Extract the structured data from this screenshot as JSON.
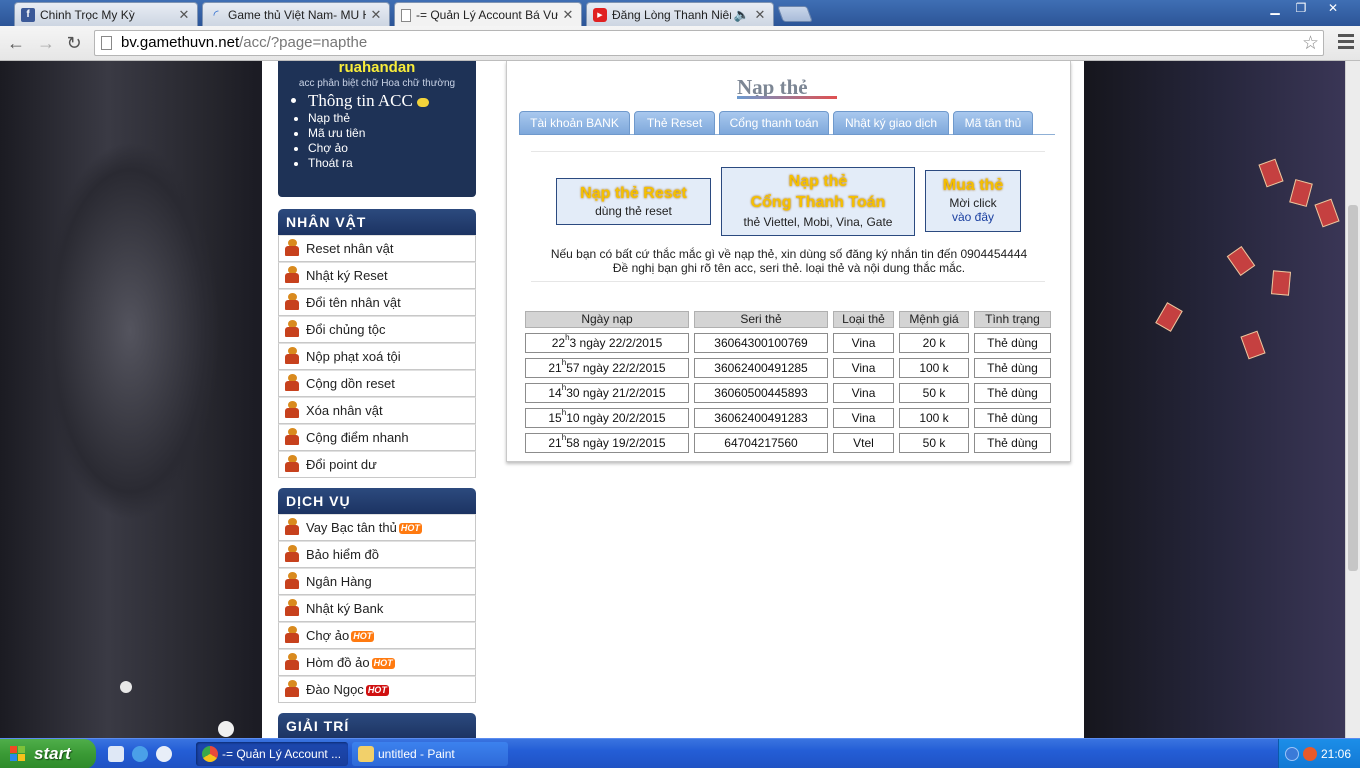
{
  "browser": {
    "tabs": [
      {
        "title": "Chinh Trọc My Kỳ",
        "icon": "facebook-icon"
      },
      {
        "title": "Game thủ Việt Nam- MU Hà N",
        "icon": "page-icon"
      },
      {
        "title": "-= Quản Lý Account Bá Vươn",
        "icon": "document-icon",
        "active": true
      },
      {
        "title": "Đăng Lòng Thanh Niên - C",
        "icon": "youtube-icon"
      }
    ],
    "url_host": "bv.gamethuvn.net",
    "url_path": "/acc/?page=napthe"
  },
  "sidebar": {
    "username": "ruahandan",
    "note": "acc phân biệt chữ Hoa chữ thường",
    "links": [
      "Thông tin ACC",
      "Nạp thẻ",
      "Mã ưu tiên",
      "Chợ ảo",
      "Thoát ra"
    ],
    "sections": [
      {
        "title": "NHÂN VẬT",
        "items": [
          "Reset nhân vật",
          "Nhật ký Reset",
          "Đổi tên nhân vật",
          "Đổi chủng tộc",
          "Nộp phạt xoá tội",
          "Cộng dồn reset",
          "Xóa nhân vật",
          "Cộng điểm nhanh",
          "Đổi point dư"
        ]
      },
      {
        "title": "DỊCH VỤ",
        "items": [
          "Vay Bạc tân thủ",
          "Bảo hiểm đồ",
          "Ngân Hàng",
          "Nhật ký Bank",
          "Chợ ảo",
          "Hòm đồ ảo",
          "Đào Ngọc"
        ]
      },
      {
        "title": "GIẢI TRÍ",
        "items": []
      }
    ],
    "hot_badge": "HOT"
  },
  "main": {
    "title": "Nạp thẻ",
    "tabs": [
      "Tài khoản BANK",
      "Thẻ Reset",
      "Cổng thanh toán",
      "Nhật ký giao dịch",
      "Mã tân thủ"
    ],
    "box1": {
      "title": "Nạp thẻ Reset",
      "sub": "dùng thẻ reset"
    },
    "box2": {
      "title1": "Nạp thẻ",
      "title2": "Cổng Thanh Toán",
      "sub": "thẻ Viettel, Mobi, Vina, Gate"
    },
    "box3": {
      "title": "Mua thẻ",
      "sub": "Mời click",
      "link": "vào đây"
    },
    "notice1": "Nếu bạn có bất cứ thắc mắc gì về nạp thẻ, xin dùng số đăng ký nhắn tin đến 0904454444",
    "notice2": "Đề nghị bạn ghi rõ tên acc, seri thẻ. loại thẻ và nội dung thắc mắc.",
    "table": {
      "headers": [
        "Ngày nạp",
        "Seri thẻ",
        "Loại thẻ",
        "Mệnh giá",
        "Tình trạng"
      ],
      "rows": [
        {
          "hour": "22",
          "rest": "3 ngày 22/2/2015",
          "seri": "36064300100769",
          "type": "Vina",
          "value": "20 k",
          "status": "Thẻ dùng"
        },
        {
          "hour": "21",
          "rest": "57 ngày 22/2/2015",
          "seri": "36062400491285",
          "type": "Vina",
          "value": "100 k",
          "status": "Thẻ dùng"
        },
        {
          "hour": "14",
          "rest": "30 ngày 21/2/2015",
          "seri": "36060500445893",
          "type": "Vina",
          "value": "50 k",
          "status": "Thẻ dùng"
        },
        {
          "hour": "15",
          "rest": "10 ngày 20/2/2015",
          "seri": "36062400491283",
          "type": "Vina",
          "value": "100 k",
          "status": "Thẻ dùng"
        },
        {
          "hour": "21",
          "rest": "58 ngày 19/2/2015",
          "seri": "64704217560",
          "type": "Vtel",
          "value": "50 k",
          "status": "Thẻ dùng"
        }
      ],
      "hour_sup": "h"
    }
  },
  "taskbar": {
    "start": "start",
    "tasks": [
      "-= Quản Lý Account ...",
      "untitled - Paint"
    ],
    "clock": "21:06"
  }
}
